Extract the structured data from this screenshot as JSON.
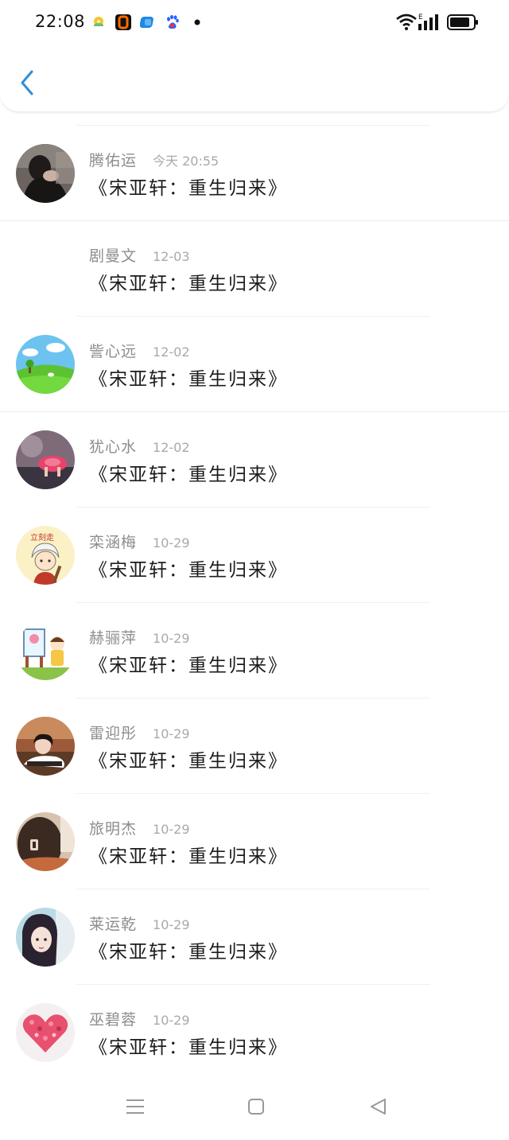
{
  "status_bar": {
    "time": "22:08",
    "app_icons": [
      "weather-app-icon",
      "orange-app-icon",
      "blue-app-icon",
      "baidu-paw-icon"
    ],
    "network_label": "E"
  },
  "header": {
    "back_icon": "chevron-left-icon",
    "accent_color": "#2f8fd8"
  },
  "comments": [
    {
      "name": "腾佑运",
      "date": "今天 20:55",
      "content": "《宋亚轩：重生归来》",
      "avatar": "dark-portrait"
    },
    {
      "name": "剧曼文",
      "date": "12-03",
      "content": "《宋亚轩：重生归来》",
      "avatar": "none"
    },
    {
      "name": "訾心远",
      "date": "12-02",
      "content": "《宋亚轩：重生归来》",
      "avatar": "meadow-landscape"
    },
    {
      "name": "犹心水",
      "date": "12-02",
      "content": "《宋亚轩：重生归来》",
      "avatar": "pink-flower-hands"
    },
    {
      "name": "栾涵梅",
      "date": "10-29",
      "content": "《宋亚轩：重生归来》",
      "avatar": "cartoon-boy"
    },
    {
      "name": "赫骊萍",
      "date": "10-29",
      "content": "《宋亚轩：重生归来》",
      "avatar": "kids-painting"
    },
    {
      "name": "雷迎彤",
      "date": "10-29",
      "content": "《宋亚轩：重生归来》",
      "avatar": "girl-portrait"
    },
    {
      "name": "旅明杰",
      "date": "10-29",
      "content": "《宋亚轩：重生归来》",
      "avatar": "hair-clip"
    },
    {
      "name": "莱运乾",
      "date": "10-29",
      "content": "《宋亚轩：重生归来》",
      "avatar": "girl-closeup"
    },
    {
      "name": "巫碧蓉",
      "date": "10-29",
      "content": "《宋亚轩：重生归来》",
      "avatar": "petal-heart"
    }
  ],
  "nav_bar": {
    "menu_icon": "menu-icon",
    "home_icon": "home-square-icon",
    "back_icon": "back-triangle-icon"
  }
}
